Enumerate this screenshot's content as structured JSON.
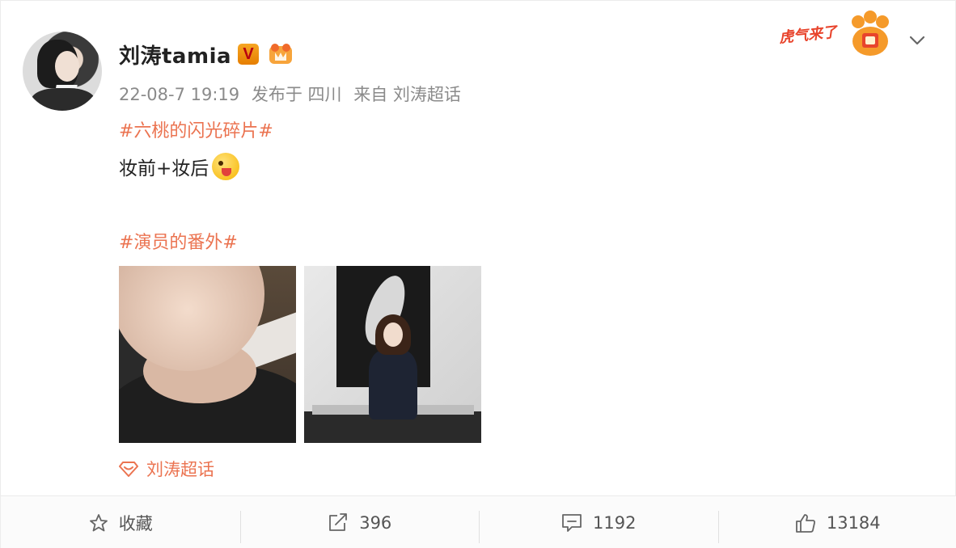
{
  "user": {
    "name": "刘涛tamia",
    "verified_badge": "V"
  },
  "meta": {
    "time": "22-08-7 19:19",
    "published_at": "发布于 四川",
    "source": "来自 刘涛超话"
  },
  "post": {
    "topic1": "#六桃的闪光碎片#",
    "text": "妆前+妆后",
    "topic2": "#演员的番外#"
  },
  "supertopic": {
    "label": "刘涛超话"
  },
  "decoration": {
    "tiger_text": "虎气来了"
  },
  "actions": {
    "favorite": "收藏",
    "repost_count": "396",
    "comment_count": "1192",
    "like_count": "13184"
  },
  "colors": {
    "accent": "#eb7350",
    "meta": "#8a8a8a",
    "badge": "#f6a623"
  }
}
